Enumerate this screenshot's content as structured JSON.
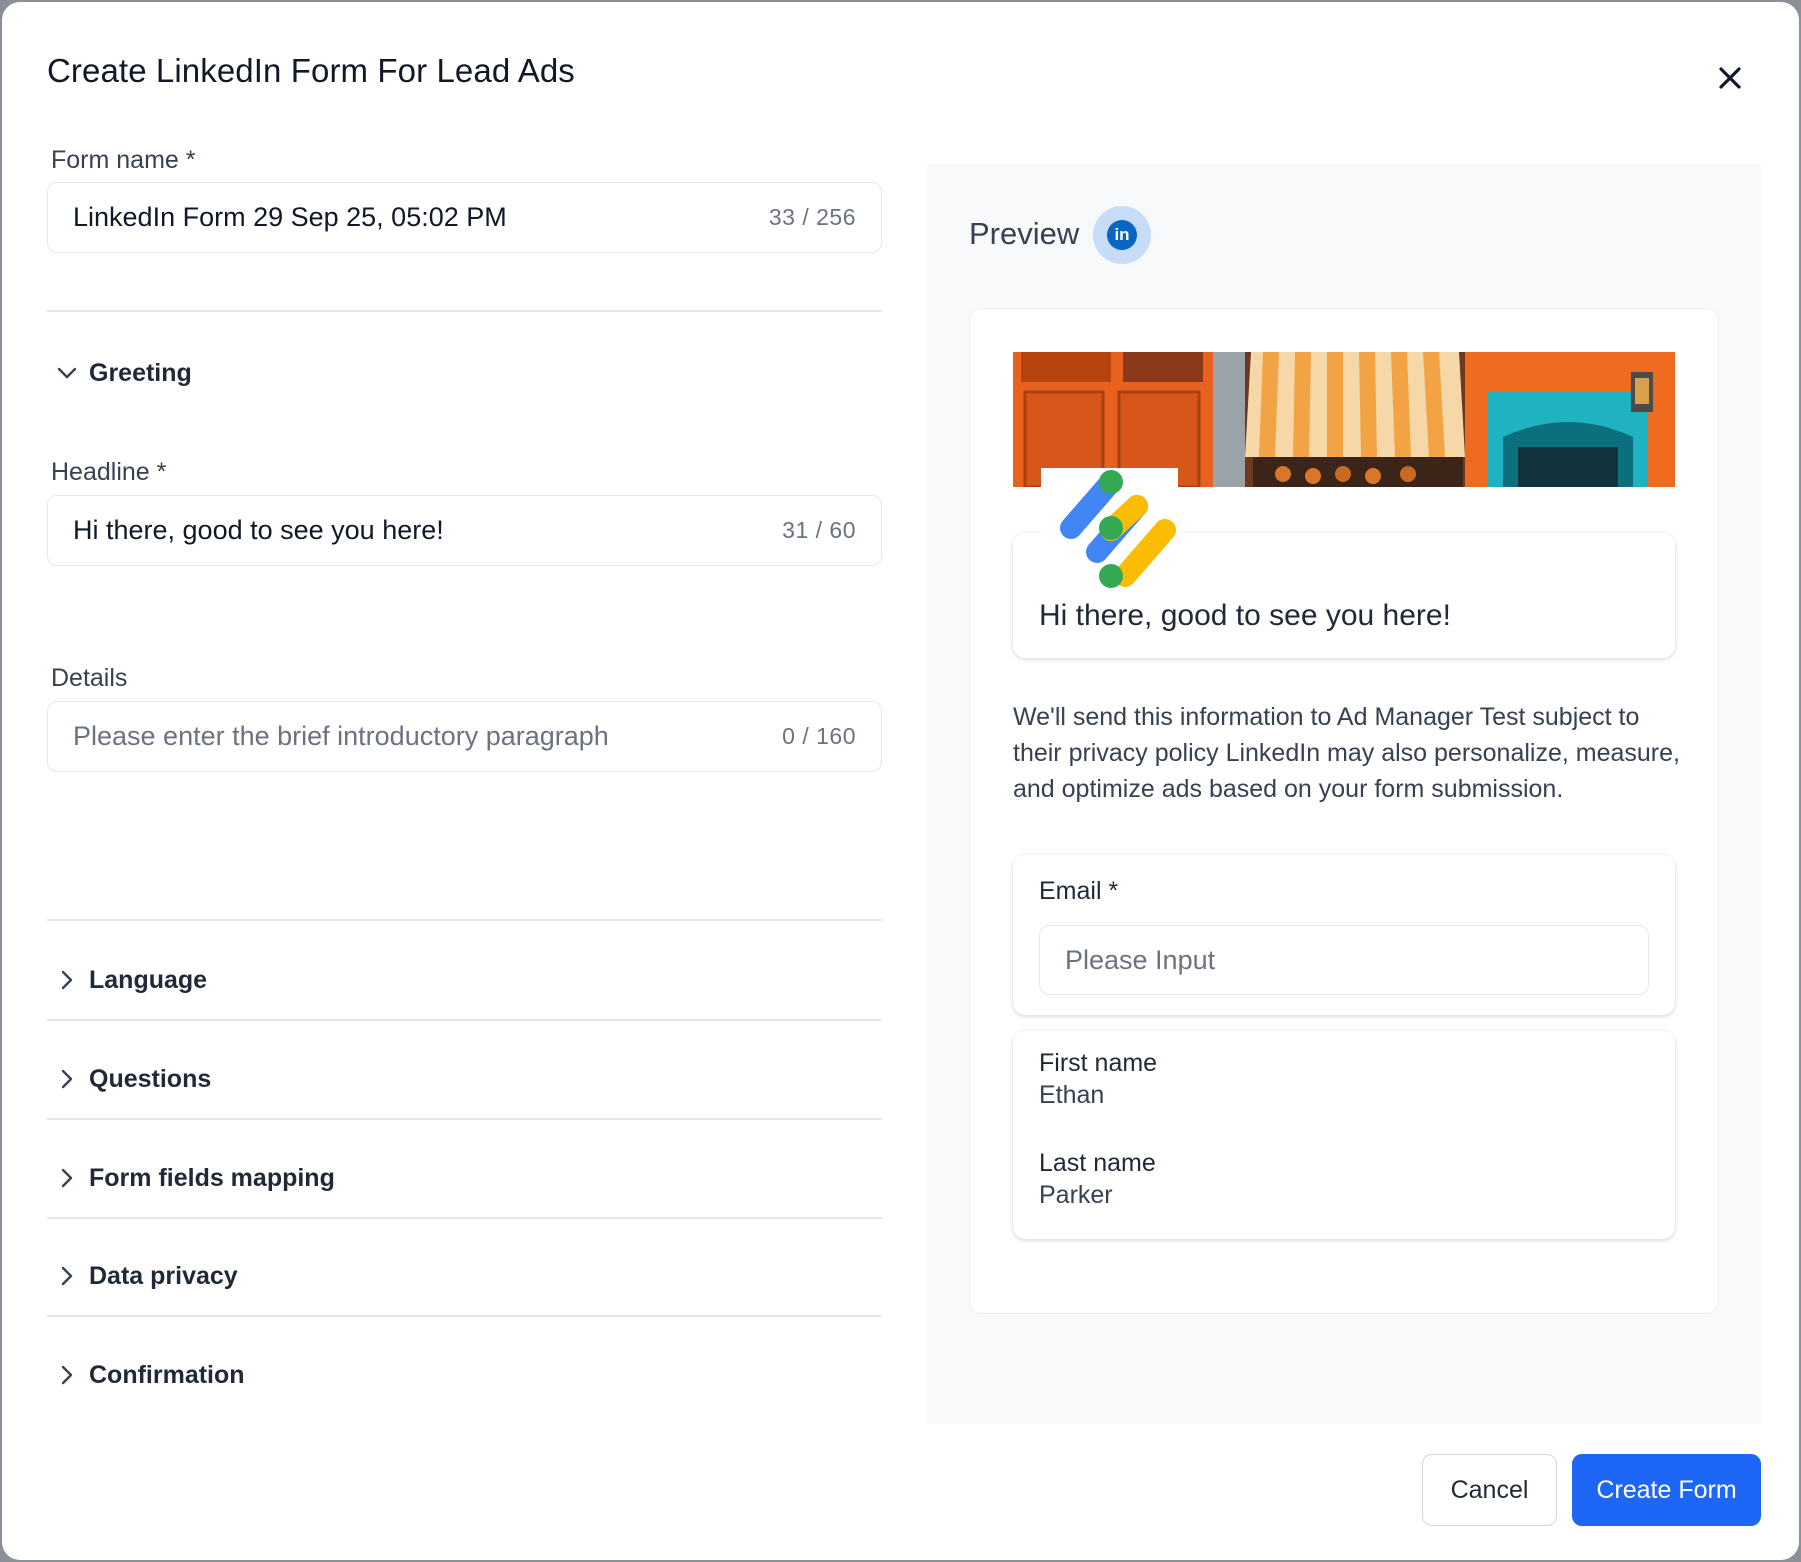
{
  "modal": {
    "title": "Create LinkedIn Form For Lead Ads",
    "close_icon": "close-icon"
  },
  "form": {
    "form_name": {
      "label": "Form name *",
      "value": "LinkedIn Form 29 Sep 25, 05:02 PM",
      "counter": "33 / 256"
    },
    "greeting": {
      "label": "Greeting",
      "expanded": true,
      "headline": {
        "label": "Headline *",
        "value": "Hi there, good to see you here!",
        "counter": "31 / 60"
      },
      "details": {
        "label": "Details",
        "placeholder": "Please enter the brief introductory paragraph",
        "counter": "0 / 160"
      }
    },
    "sections": [
      {
        "label": "Language"
      },
      {
        "label": "Questions"
      },
      {
        "label": "Form fields mapping"
      },
      {
        "label": "Data privacy"
      },
      {
        "label": "Confirmation"
      }
    ]
  },
  "preview": {
    "title": "Preview",
    "badge": "in",
    "headline": "Hi there, good to see you here!",
    "disclaimer": "We'll send this information to Ad Manager Test subject to their privacy policy LinkedIn may also personalize, measure, and optimize ads based on your form submission.",
    "email": {
      "label": "Email *",
      "placeholder": "Please Input"
    },
    "first_name": {
      "label": "First name",
      "value": "Ethan"
    },
    "last_name": {
      "label": "Last name",
      "value": "Parker"
    }
  },
  "footer": {
    "cancel_label": "Cancel",
    "create_label": "Create Form"
  },
  "colors": {
    "primary": "#1e66f5",
    "linkedin": "#0a66c2",
    "preview_bg": "#f8f9fa"
  }
}
